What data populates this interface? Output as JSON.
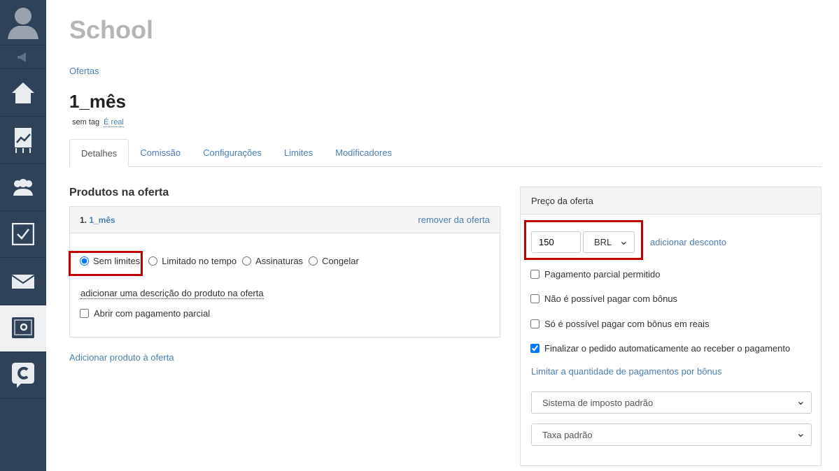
{
  "header": {
    "title": "School",
    "breadcrumb": "Ofertas",
    "offer_name": "1_mês",
    "tag": "sem tag",
    "real_label": "É real"
  },
  "tabs": [
    "Detalhes",
    "Comissão",
    "Configurações",
    "Limites",
    "Modificadores"
  ],
  "products": {
    "title": "Produtos na oferta",
    "item_number": "1.",
    "item_name": "1_mês",
    "remove": "remover da oferta",
    "radios": [
      "Sem limites",
      "Limitado no tempo",
      "Assinaturas",
      "Congelar"
    ],
    "selected": "Sem limites",
    "add_description": "adicionar uma descrição do produto na oferta",
    "partial_open": "Abrir com pagamento parcial",
    "add_product": "Adicionar produto à oferta"
  },
  "price": {
    "title": "Preço da oferta",
    "amount": "150",
    "currency": "BRL",
    "add_discount": "adicionar desconto",
    "options": [
      {
        "label": "Pagamento parcial permitido",
        "checked": false
      },
      {
        "label": "Não é possível pagar com bônus",
        "checked": false
      },
      {
        "label": "Só é possível pagar com bônus em reais",
        "checked": false
      },
      {
        "label": "Finalizar o pedido automaticamente ao receber o pagamento",
        "checked": true
      }
    ],
    "limit_link": "Limitar a quantidade de pagamentos por bônus",
    "tax_system": "Sistema de imposto padrão",
    "tax_rate": "Taxa padrão"
  }
}
